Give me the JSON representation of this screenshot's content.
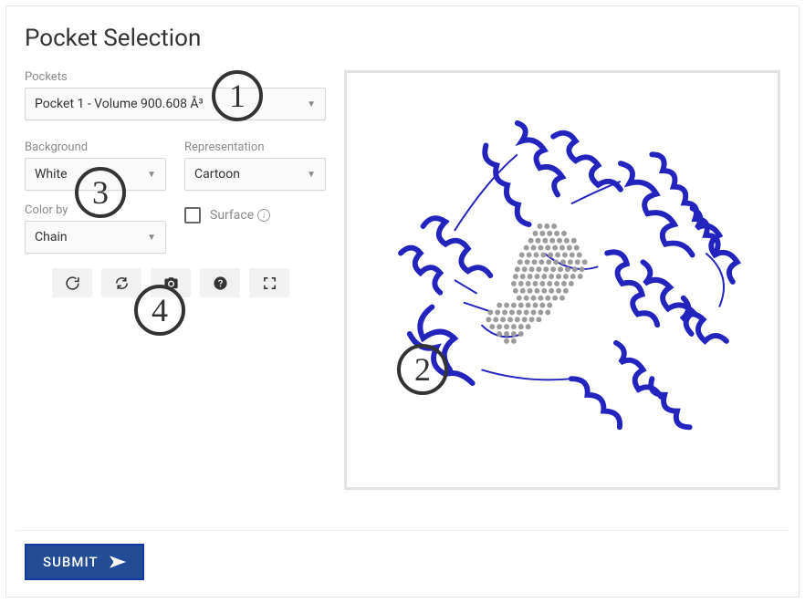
{
  "title": "Pocket Selection",
  "pockets": {
    "label": "Pockets",
    "selected": "Pocket 1 - Volume 900.608 Å³"
  },
  "background": {
    "label": "Background",
    "selected": "White"
  },
  "representation": {
    "label": "Representation",
    "selected": "Cartoon"
  },
  "color_by": {
    "label": "Color by",
    "selected": "Chain"
  },
  "surface": {
    "label": "Surface",
    "checked": false
  },
  "submit_label": "SUBMIT",
  "callouts": {
    "1": "1",
    "2": "2",
    "3": "3",
    "4": "4"
  }
}
